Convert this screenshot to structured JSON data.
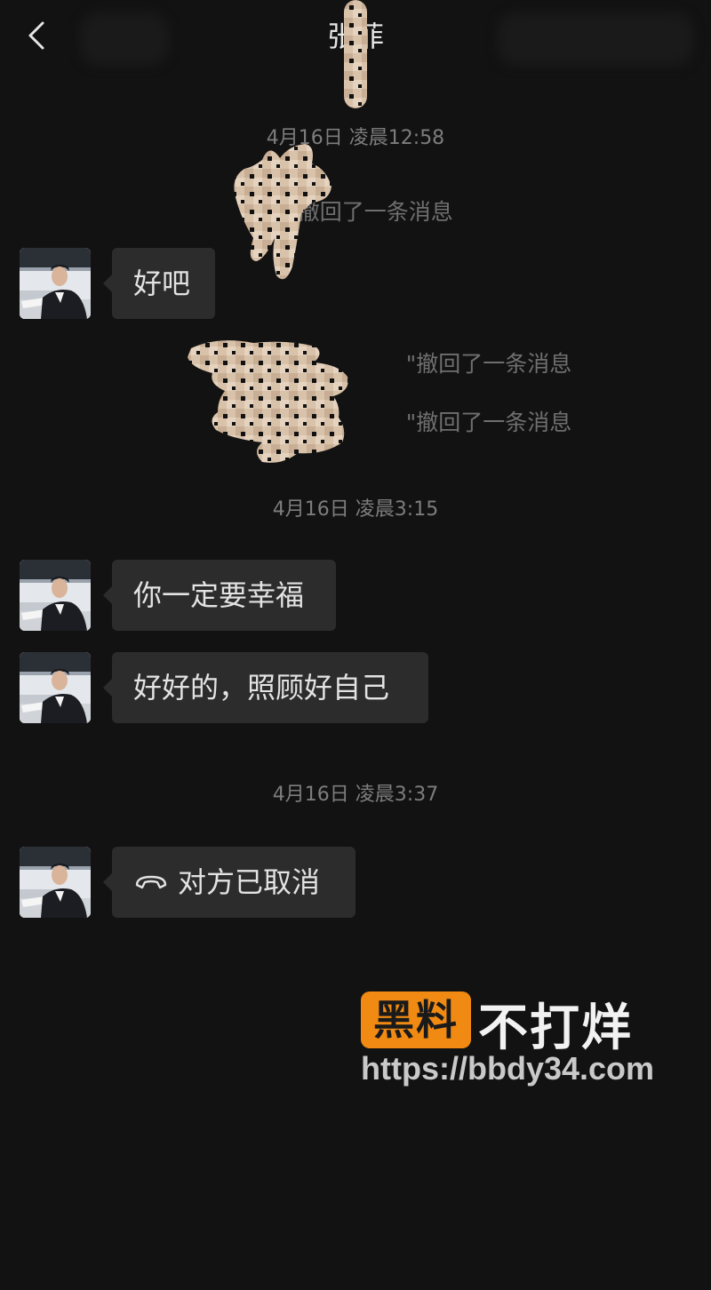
{
  "header": {
    "title": "张菲",
    "back_icon": "chevron-left-icon"
  },
  "messages": {
    "ts1": "4月16日 凌晨12:58",
    "recall1": "\"张 撤回了一条消息",
    "msg1": "好吧",
    "recall2": "\"撤回了一条消息",
    "recall3": "\"撤回了一条消息",
    "ts2": "4月16日 凌晨3:15",
    "msg2": "你一定要幸福",
    "msg3": "好好的，照顾好自己",
    "ts3": "4月16日 凌晨3:37",
    "msg4": "对方已取消",
    "call_icon": "phone-hangup-icon"
  },
  "watermark": {
    "badge": "黑料",
    "text": "不打烊",
    "url": "https://bbdy34.com"
  },
  "colors": {
    "background": "#121212",
    "bubble": "#2c2c2c",
    "watermark_orange": "#f08a12"
  }
}
